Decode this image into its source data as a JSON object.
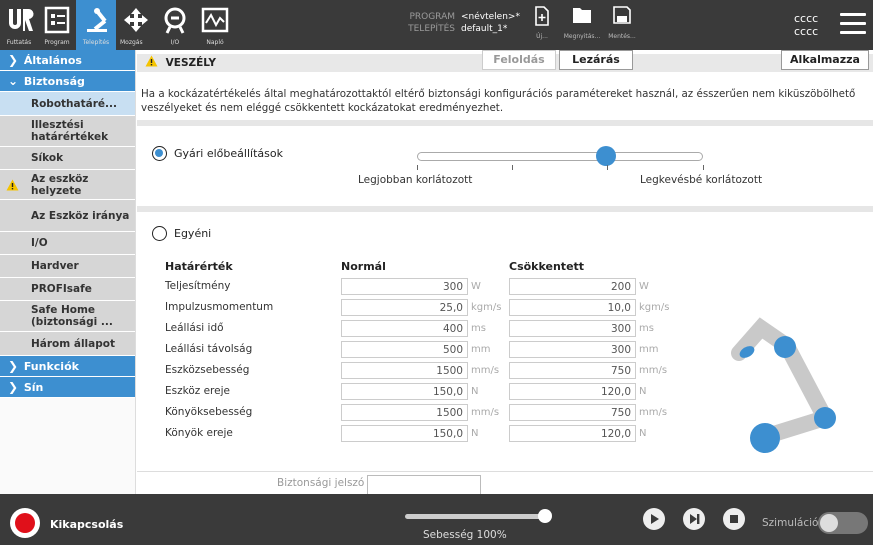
{
  "topbar": {
    "nav": [
      {
        "icon": "ur-logo-icon",
        "label": "Futtatás"
      },
      {
        "icon": "program-icon",
        "label": "Program"
      },
      {
        "icon": "robot-arm-icon",
        "label": "Telepítés"
      },
      {
        "icon": "move-icon",
        "label": "Mozgás"
      },
      {
        "icon": "io-icon",
        "label": "I/O"
      },
      {
        "icon": "log-icon",
        "label": "Napló"
      }
    ],
    "program_key": "PROGRAM",
    "program_value": "<névtelen>*",
    "install_key": "TELEPÍTÉS",
    "install_value": "default_1*",
    "file_buttons": [
      {
        "icon": "new-file-icon",
        "label": "Új..."
      },
      {
        "icon": "folder-icon",
        "label": "Megnyitás..."
      },
      {
        "icon": "save-icon",
        "label": "Mentés..."
      }
    ],
    "user_line1": "cccc",
    "user_line2": "cccc"
  },
  "sidebar": {
    "general": "Általános",
    "safety": "Biztonság",
    "items": [
      "Robothatáré...",
      "Illesztési határértékek",
      "Síkok",
      "Az eszköz helyzete",
      "Az Eszköz iránya",
      "I/O",
      "Hardver",
      "PROFIsafe",
      "Safe Home (biztonsági ...",
      "Három állapot"
    ],
    "features": "Funkciók",
    "rail": "Sín"
  },
  "main": {
    "warning_title": "VESZÉLY",
    "warning_text": "Ha a kockázatértékelés által meghatározottaktól eltérő biztonsági konfigurációs paramétereket használ, az ésszerűen nem kiküszöbölhető veszélyeket és nem eléggé csökkentett kockázatokat eredményezhet.",
    "factory_label": "Gyári előbeállítások",
    "slider_left": "Legjobban korlátozott",
    "slider_right": "Legkevésbé korlátozott",
    "slider_level": 0.66,
    "custom_label": "Egyéni",
    "col_limit": "Határérték",
    "col_normal": "Normál",
    "col_reduced": "Csökkentett",
    "rows": [
      {
        "name": "Teljesítmény",
        "normal": "300",
        "reduced": "200",
        "unit": "W"
      },
      {
        "name": "Impulzusmomentum",
        "normal": "25,0",
        "reduced": "10,0",
        "unit": "kgm/s"
      },
      {
        "name": "Leállási idő",
        "normal": "400",
        "reduced": "300",
        "unit": "ms"
      },
      {
        "name": "Leállási távolság",
        "normal": "500",
        "reduced": "300",
        "unit": "mm"
      },
      {
        "name": "Eszközsebesség",
        "normal": "1500",
        "reduced": "750",
        "unit": "mm/s"
      },
      {
        "name": "Eszköz ereje",
        "normal": "150,0",
        "reduced": "120,0",
        "unit": "N"
      },
      {
        "name": "Könyöksebesség",
        "normal": "1500",
        "reduced": "750",
        "unit": "mm/s"
      },
      {
        "name": "Könyök ereje",
        "normal": "150,0",
        "reduced": "120,0",
        "unit": "N"
      }
    ],
    "password_label": "Biztonsági jelszó",
    "unlock": "Feloldás",
    "lock": "Lezárás",
    "apply": "Alkalmazza"
  },
  "footer": {
    "power": "Kikapcsolás",
    "speed": "Sebesség 100%",
    "speed_level": 1.0,
    "simulation": "Szimuláció",
    "colors": {
      "accent": "#3d8fd0",
      "power_red": "#e0101a",
      "bar": "#3a3a3a"
    }
  }
}
